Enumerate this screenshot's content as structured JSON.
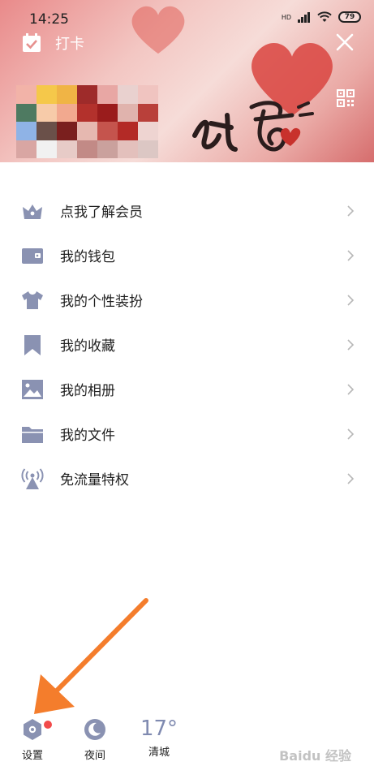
{
  "status_bar": {
    "time": "14:25",
    "network": "HD",
    "battery": "79"
  },
  "header": {
    "checkin_label": "打卡"
  },
  "menu": {
    "items": [
      {
        "label": "点我了解会员",
        "icon": "vip-crown-icon"
      },
      {
        "label": "我的钱包",
        "icon": "wallet-icon"
      },
      {
        "label": "我的个性装扮",
        "icon": "tshirt-icon"
      },
      {
        "label": "我的收藏",
        "icon": "bookmark-icon"
      },
      {
        "label": "我的相册",
        "icon": "photo-album-icon"
      },
      {
        "label": "我的文件",
        "icon": "folder-icon"
      },
      {
        "label": "免流量特权",
        "icon": "broadcast-tower-icon"
      }
    ]
  },
  "bottom": {
    "settings_label": "设置",
    "night_label": "夜间",
    "weather_temp": "17°",
    "weather_city": "清城"
  },
  "watermark": "Baidu 经验",
  "colors": {
    "icon": "#8a92b2",
    "accent_arrow": "#f47d2c",
    "badge": "#f24b4b"
  }
}
